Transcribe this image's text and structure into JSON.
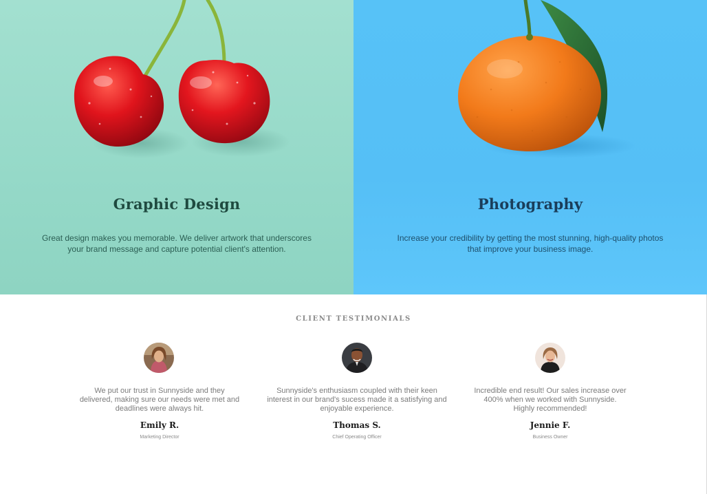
{
  "services": {
    "graphic_design": {
      "title": "Graphic Design",
      "text": "Great design makes you memorable. We deliver artwork that underscores your brand message and capture potential client's attention.",
      "image": "cherries-illustration",
      "background": "#95d9c8"
    },
    "photography": {
      "title": "Photography",
      "text": "Increase your credibility by getting the most stunning, high-quality photos that improve your business image.",
      "image": "orange-illustration",
      "background": "#57c2f7"
    }
  },
  "testimonials": {
    "heading": "CLIENT TESTIMONIALS",
    "items": [
      {
        "quote": "We put our trust in Sunnyside and they delivered, making sure our needs were met and deadlines were always hit.",
        "name": "Emily R.",
        "role": "Marketing Director",
        "avatar": "avatar-emily"
      },
      {
        "quote": "Sunnyside's enthusiasm coupled with their keen interest in our brand's sucess made it a satisfying and enjoyable experience.",
        "name": "Thomas S.",
        "role": "Chief Operating Officer",
        "avatar": "avatar-thomas"
      },
      {
        "quote": "Incredible end result! Our sales increase over 400% when we worked with Sunnyside. Highly recommended!",
        "name": "Jennie F.",
        "role": "Business Owner",
        "avatar": "avatar-jennie"
      }
    ]
  }
}
